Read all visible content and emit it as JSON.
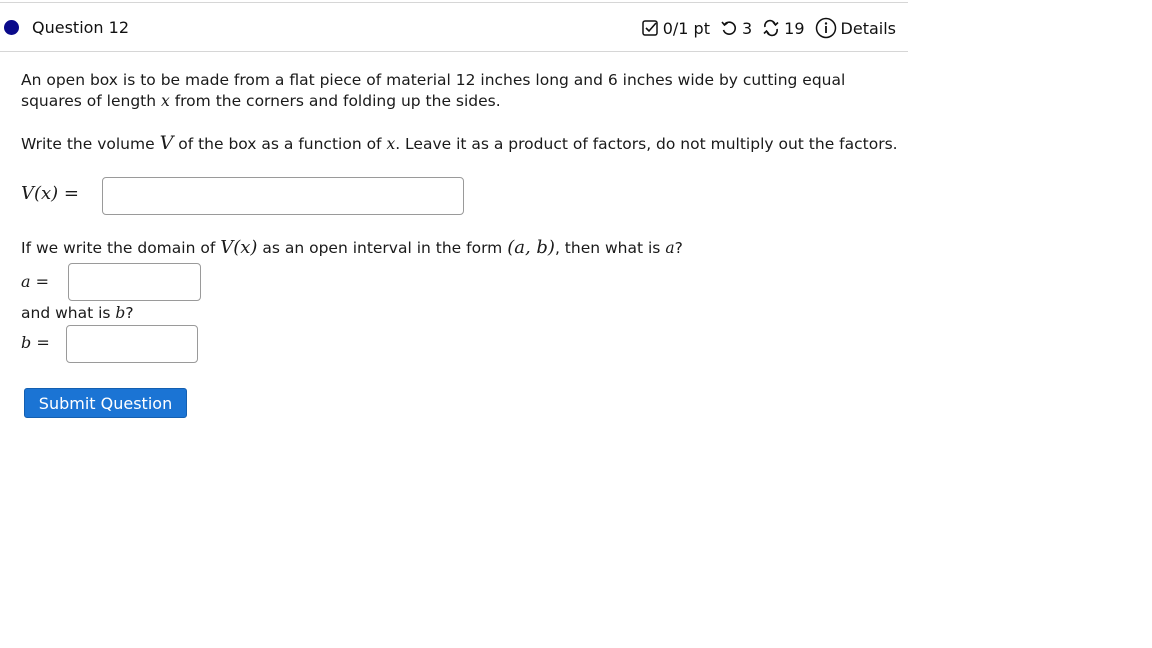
{
  "header": {
    "question_title": "Question 12",
    "score": "0/1 pt",
    "retries": "3",
    "attempts": "19",
    "details_label": "Details"
  },
  "problem": {
    "intro_p1": "An open box is to be made from a flat piece of material 12 inches long and 6 inches wide by cutting equal squares of length ",
    "intro_var": "x",
    "intro_p2": " from the corners and folding up the sides.",
    "volume_p1": "Write the volume ",
    "volume_V": "V",
    "volume_p2": " of the box as a function of ",
    "volume_x": "x",
    "volume_p3": ". Leave it as a product of factors, do not multiply out the factors.",
    "v_label": "V(x) =",
    "domain_p1": "If we write the domain of ",
    "domain_Vx": "V(x)",
    "domain_p2": " as an open interval in the form ",
    "domain_ab": "(a, b)",
    "domain_p3": ", then what is ",
    "domain_a": "a",
    "domain_p4": "?",
    "a_label": "a =",
    "and_text": "and what is ",
    "and_b": "b",
    "and_q": "?",
    "b_label": "b =",
    "v_value": "",
    "a_value": "",
    "b_value": ""
  },
  "submit_label": "Submit Question",
  "colors": {
    "bullet": "#0a0a8a",
    "submit": "#1b74d4"
  },
  "icons": [
    "checkbox-icon",
    "retry-icon",
    "attempts-icon",
    "info-icon"
  ]
}
